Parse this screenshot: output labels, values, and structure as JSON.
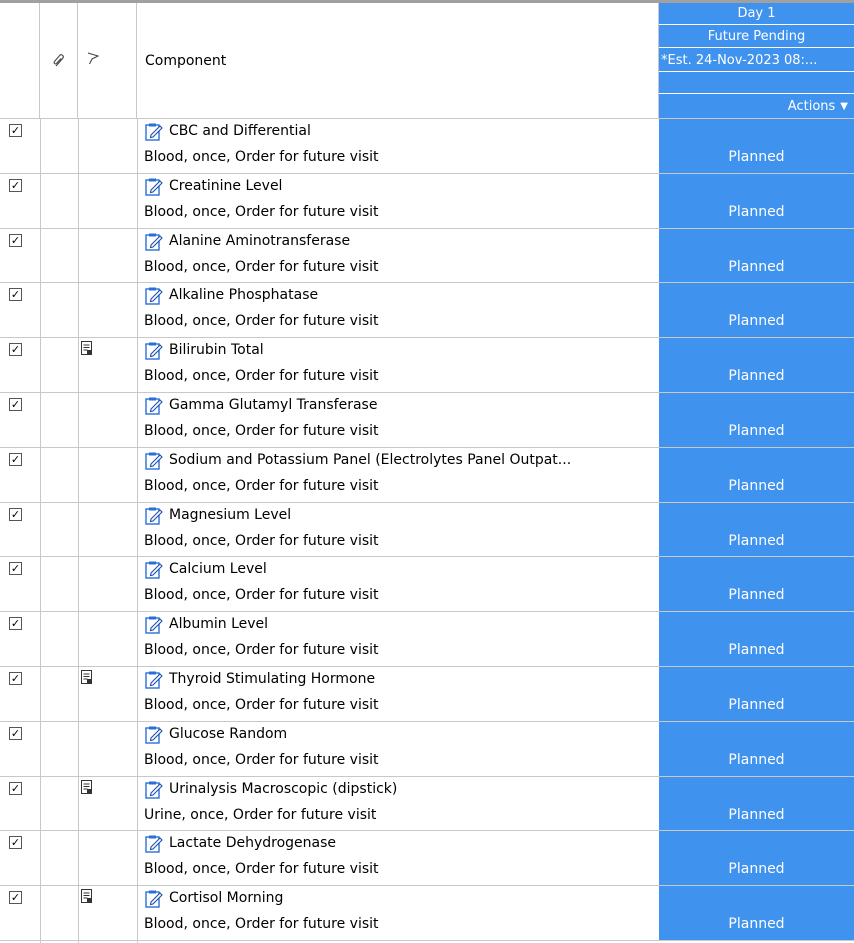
{
  "header": {
    "component_label": "Component",
    "attach_icon": "paperclip-icon",
    "flag_icon": "flag-icon",
    "day_label": "Day 1",
    "status_label": "Future Pending",
    "est_label": "*Est. 24-Nov-2023 08:...",
    "actions_label": "Actions"
  },
  "colors": {
    "accent": "#3f93ee",
    "grid_line": "#c8c8c8"
  },
  "rows": [
    {
      "name": "CBC and Differential",
      "detail": "Blood, once, Order for future visit",
      "status": "Planned",
      "checked": true,
      "has_doc": false
    },
    {
      "name": "Creatinine Level",
      "detail": "Blood, once, Order for future visit",
      "status": "Planned",
      "checked": true,
      "has_doc": false
    },
    {
      "name": "Alanine Aminotransferase",
      "detail": "Blood, once, Order for future visit",
      "status": "Planned",
      "checked": true,
      "has_doc": false
    },
    {
      "name": "Alkaline Phosphatase",
      "detail": "Blood, once, Order for future visit",
      "status": "Planned",
      "checked": true,
      "has_doc": false
    },
    {
      "name": "Bilirubin Total",
      "detail": "Blood, once, Order for future visit",
      "status": "Planned",
      "checked": true,
      "has_doc": true
    },
    {
      "name": "Gamma Glutamyl Transferase",
      "detail": "Blood, once, Order for future visit",
      "status": "Planned",
      "checked": true,
      "has_doc": false
    },
    {
      "name": "Sodium and Potassium Panel (Electrolytes Panel Outpat...",
      "detail": "Blood, once, Order for future visit",
      "status": "Planned",
      "checked": true,
      "has_doc": false
    },
    {
      "name": "Magnesium Level",
      "detail": "Blood, once, Order for future visit",
      "status": "Planned",
      "checked": true,
      "has_doc": false
    },
    {
      "name": "Calcium Level",
      "detail": "Blood, once, Order for future visit",
      "status": "Planned",
      "checked": true,
      "has_doc": false
    },
    {
      "name": "Albumin Level",
      "detail": "Blood, once, Order for future visit",
      "status": "Planned",
      "checked": true,
      "has_doc": false
    },
    {
      "name": "Thyroid Stimulating Hormone",
      "detail": "Blood, once, Order for future visit",
      "status": "Planned",
      "checked": true,
      "has_doc": true
    },
    {
      "name": "Glucose Random",
      "detail": "Blood, once, Order for future visit",
      "status": "Planned",
      "checked": true,
      "has_doc": false
    },
    {
      "name": "Urinalysis Macroscopic (dipstick)",
      "detail": "Urine, once, Order for future visit",
      "status": "Planned",
      "checked": true,
      "has_doc": true
    },
    {
      "name": "Lactate Dehydrogenase",
      "detail": "Blood, once, Order for future visit",
      "status": "Planned",
      "checked": true,
      "has_doc": false
    },
    {
      "name": "Cortisol Morning",
      "detail": "Blood, once, Order for future visit",
      "status": "Planned",
      "checked": true,
      "has_doc": true
    }
  ]
}
